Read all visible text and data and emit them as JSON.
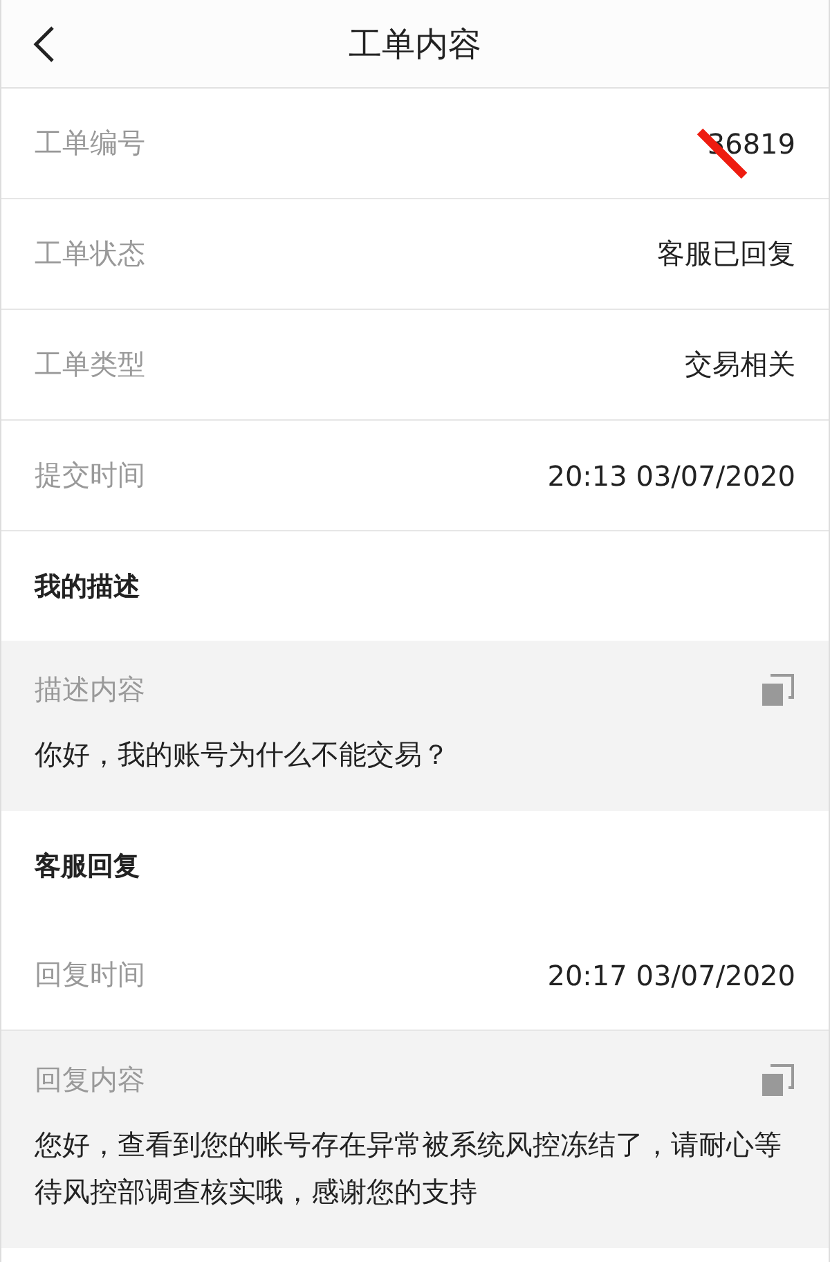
{
  "header": {
    "title": "工单内容"
  },
  "fields": [
    {
      "label": "工单编号",
      "value": "36819",
      "redacted": true
    },
    {
      "label": "工单状态",
      "value": "客服已回复",
      "redacted": false
    },
    {
      "label": "工单类型",
      "value": "交易相关",
      "redacted": false
    },
    {
      "label": "提交时间",
      "value": "20:13 03/07/2020",
      "redacted": false
    }
  ],
  "sections": [
    {
      "title": "我的描述",
      "items": [
        {
          "kind": "content",
          "label": "描述内容",
          "text": "你好，我的账号为什么不能交易？"
        }
      ]
    },
    {
      "title": "客服回复",
      "items": [
        {
          "kind": "field",
          "label": "回复时间",
          "value": "20:17 03/07/2020"
        },
        {
          "kind": "content",
          "label": "回复内容",
          "text": "您好，查看到您的帐号存在异常被系统风控冻结了，请耐心等待风控部调查核实哦，感谢您的支持"
        }
      ]
    }
  ]
}
